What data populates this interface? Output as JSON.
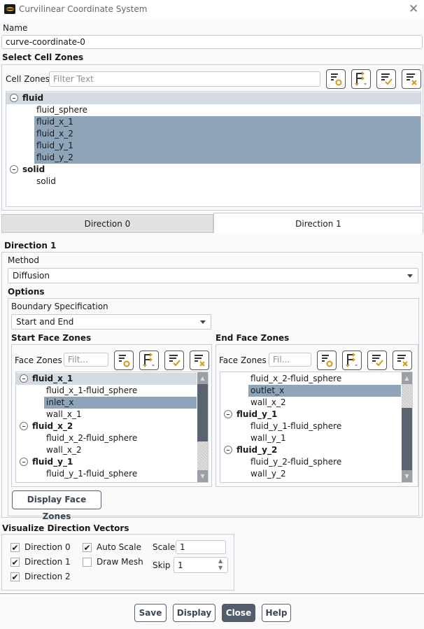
{
  "window": {
    "title": "Curvilinear Coordinate System"
  },
  "name": {
    "label": "Name",
    "value": "curve-coordinate-0"
  },
  "cell_zones": {
    "section": "Select Cell Zones",
    "label": "Cell Zones",
    "placeholder": "Filter Text",
    "rows": [
      {
        "t": "fluid",
        "g": true
      },
      {
        "t": "fluid_sphere"
      },
      {
        "t": "fluid_x_1",
        "s": true
      },
      {
        "t": "fluid_x_2",
        "s": true
      },
      {
        "t": "fluid_y_1",
        "s": true
      },
      {
        "t": "fluid_y_2",
        "s": true
      },
      {
        "t": "solid",
        "g": true
      },
      {
        "t": "solid"
      }
    ]
  },
  "tabs": [
    "Direction 0",
    "Direction 1"
  ],
  "direction": {
    "heading": "Direction 1",
    "method_label": "Method",
    "method": "Diffusion",
    "options_label": "Options",
    "bspec_label": "Boundary Specification",
    "bspec": "Start and End",
    "start": {
      "title": "Start Face Zones",
      "label": "Face Zones",
      "placeholder": "Filt...",
      "rows": [
        {
          "t": "fluid_x_1",
          "g": true,
          "h": true
        },
        {
          "t": "fluid_x_1-fluid_sphere"
        },
        {
          "t": "inlet_x",
          "s": true
        },
        {
          "t": "wall_x_1"
        },
        {
          "t": "fluid_x_2",
          "g": true
        },
        {
          "t": "fluid_x_2-fluid_sphere"
        },
        {
          "t": "wall_x_2"
        },
        {
          "t": "fluid_y_1",
          "g": true
        },
        {
          "t": "fluid_y_1-fluid_sphere"
        }
      ]
    },
    "end": {
      "title": "End Face Zones",
      "label": "Face Zones",
      "placeholder": "Fil...",
      "rows": [
        {
          "t": "fluid_x_2-fluid_sphere"
        },
        {
          "t": "outlet_x",
          "s": true
        },
        {
          "t": "wall_x_2"
        },
        {
          "t": "fluid_y_1",
          "g": true
        },
        {
          "t": "fluid_y_1-fluid_sphere"
        },
        {
          "t": "wall_y_1"
        },
        {
          "t": "fluid_y_2",
          "g": true
        },
        {
          "t": "fluid_y_2-fluid_sphere"
        },
        {
          "t": "wall_y_2"
        }
      ]
    },
    "display_face_zones": "Display Face Zones"
  },
  "visualize": {
    "heading": "Visualize Direction Vectors",
    "dir0": "Direction 0",
    "dir1": "Direction 1",
    "dir2": "Direction 2",
    "auto_scale": "Auto Scale",
    "draw_mesh": "Draw Mesh",
    "scale_label": "Scale",
    "scale": "1",
    "skip_label": "Skip",
    "skip": "1",
    "checked": {
      "dir0": true,
      "dir1": true,
      "dir2": true,
      "auto_scale": true,
      "draw_mesh": false
    }
  },
  "buttons": {
    "save": "Save",
    "display": "Display",
    "close": "Close",
    "help": "Help"
  }
}
